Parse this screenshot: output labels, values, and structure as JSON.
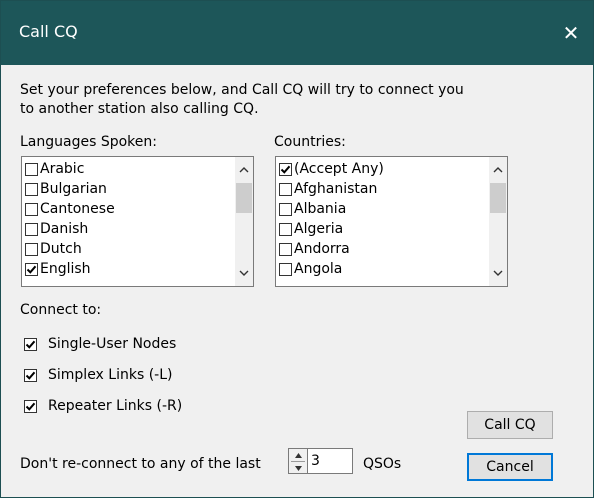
{
  "window": {
    "title": "Call CQ"
  },
  "intro": {
    "line1": "Set your preferences below, and Call CQ will try to connect you",
    "line2": "to another station also calling CQ."
  },
  "languages": {
    "label": "Languages Spoken:",
    "items": [
      {
        "label": "Arabic",
        "checked": false
      },
      {
        "label": "Bulgarian",
        "checked": false
      },
      {
        "label": "Cantonese",
        "checked": false
      },
      {
        "label": "Danish",
        "checked": false
      },
      {
        "label": "Dutch",
        "checked": false
      },
      {
        "label": "English",
        "checked": true
      }
    ]
  },
  "countries": {
    "label": "Countries:",
    "items": [
      {
        "label": "(Accept Any)",
        "checked": true
      },
      {
        "label": "Afghanistan",
        "checked": false
      },
      {
        "label": "Albania",
        "checked": false
      },
      {
        "label": "Algeria",
        "checked": false
      },
      {
        "label": "Andorra",
        "checked": false
      },
      {
        "label": "Angola",
        "checked": false
      }
    ]
  },
  "connect": {
    "label": "Connect to:",
    "options": [
      {
        "label": "Single-User Nodes",
        "checked": true
      },
      {
        "label": "Simplex Links (-L)",
        "checked": true
      },
      {
        "label": "Repeater Links (-R)",
        "checked": true
      }
    ]
  },
  "reconnect": {
    "prefix": "Don't re-connect to any of the last",
    "value": "3",
    "suffix": "QSOs"
  },
  "buttons": {
    "call": "Call CQ",
    "cancel": "Cancel"
  },
  "icons": {
    "close": "close-icon",
    "check": "checkmark-icon",
    "up": "chevron-up-icon",
    "down": "chevron-down-icon"
  }
}
